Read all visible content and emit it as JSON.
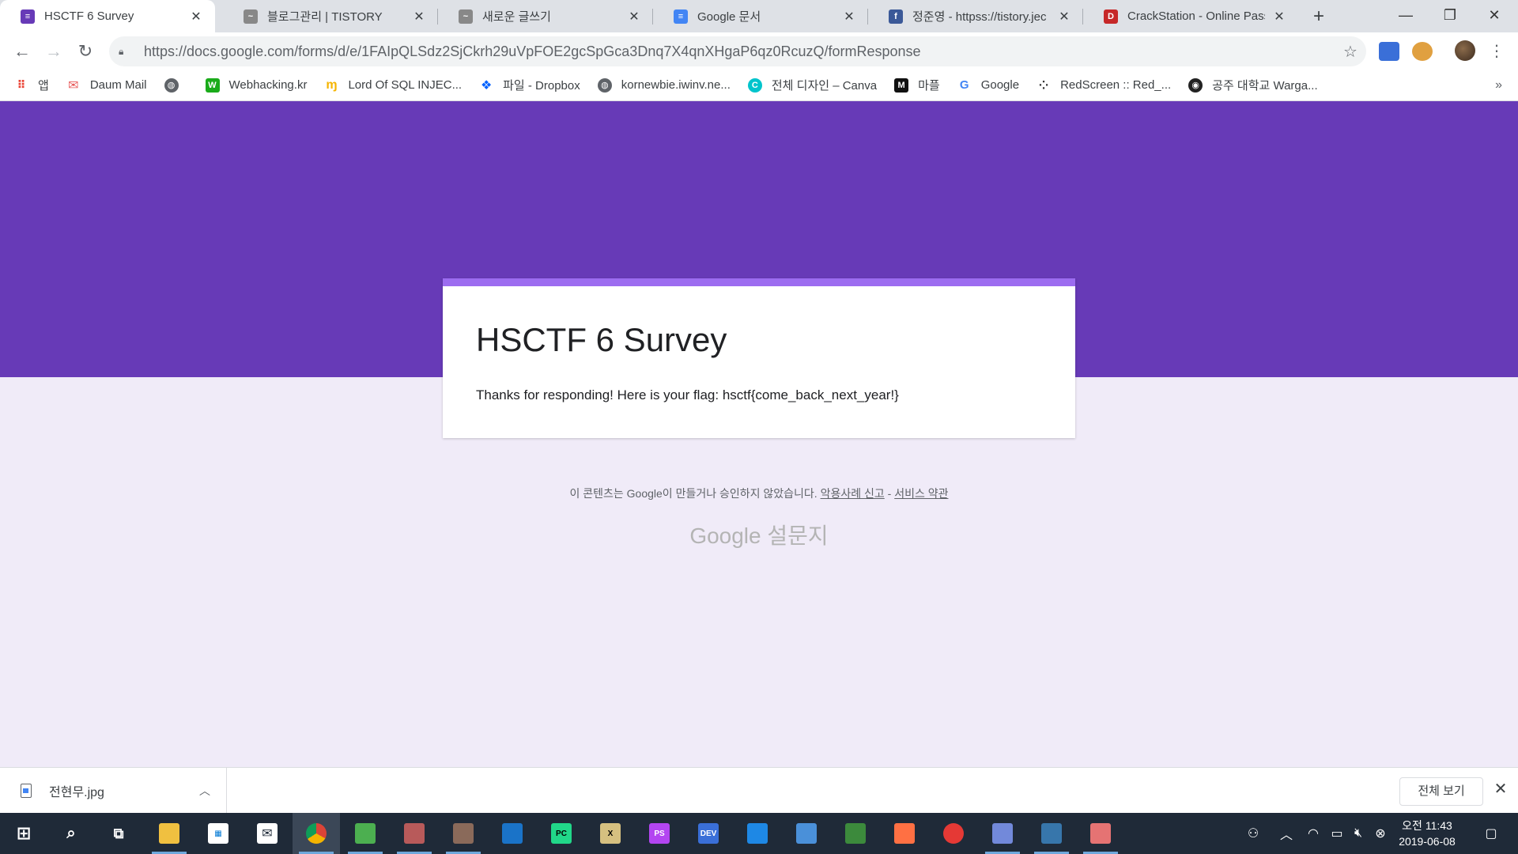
{
  "browser": {
    "tabs": [
      {
        "title": "HSCTF 6 Survey",
        "favicon": "google-forms-icon",
        "color": "#673ab7",
        "active": true
      },
      {
        "title": "블로그관리 | TISTORY",
        "favicon": "tistory-icon",
        "color": "#888888"
      },
      {
        "title": "새로운 글쓰기",
        "favicon": "tistory-icon",
        "color": "#888888"
      },
      {
        "title": "Google 문서",
        "favicon": "google-docs-icon",
        "color": "#4285f4"
      },
      {
        "title": "정준영 - httpss://tistory.jec",
        "favicon": "facebook-icon",
        "color": "#3b5998"
      },
      {
        "title": "CrackStation - Online Passw",
        "favicon": "crackstation-icon",
        "color": "#c62828"
      }
    ],
    "new_tab_symbol": "+",
    "window_controls": {
      "minimize": "—",
      "maximize": "❐",
      "close": "✕"
    },
    "url": "https://docs.google.com/forms/d/e/1FAIpQLSdz2SjCkrh29uVpFOE2gcSpGca3Dnq7X4qnXHgaP6qz0RcuzQ/formResponse",
    "bookmarks": [
      {
        "label": "앱",
        "icon": "apps-grid-icon",
        "color": "#ea4335"
      },
      {
        "label": "Daum Mail",
        "icon": "mail-icon",
        "color": "#e85b5b"
      },
      {
        "label": "",
        "icon": "globe-icon",
        "color": "#5f6368"
      },
      {
        "label": "Webhacking.kr",
        "icon": "webhacking-icon",
        "color": "#1aab1a"
      },
      {
        "label": "Lord Of SQL INJEC...",
        "icon": "mcdonalds-icon",
        "color": "#f5b400"
      },
      {
        "label": "파일 - Dropbox",
        "icon": "dropbox-icon",
        "color": "#0061ff"
      },
      {
        "label": "kornewbie.iwinv.ne...",
        "icon": "globe-icon",
        "color": "#5f6368"
      },
      {
        "label": "전체 디자인 – Canva",
        "icon": "canva-icon",
        "color": "#00c4cc"
      },
      {
        "label": "마플",
        "icon": "marpple-icon",
        "color": "#111111"
      },
      {
        "label": "Google",
        "icon": "google-icon",
        "color": "#4285f4"
      },
      {
        "label": "RedScreen :: Red_...",
        "icon": "redscreen-icon",
        "color": "#333333"
      },
      {
        "label": "공주 대학교 Warga...",
        "icon": "wargame-icon",
        "color": "#222222"
      }
    ],
    "bookmarks_overflow": "»"
  },
  "form": {
    "title": "HSCTF 6 Survey",
    "confirmation": "Thanks for responding! Here is your flag: hsctf{come_back_next_year!}",
    "footer_text": "이 콘텐츠는 Google이 만들거나 승인하지 않았습니다. ",
    "report_link": "악용사례 신고",
    "separator": " - ",
    "terms_link": "서비스 약관",
    "logo_text": "Google 설문지",
    "banner_color": "#673ab7",
    "accent_color": "#9c6cf0"
  },
  "downloads": {
    "file_name": "전현무.jpg",
    "show_all": "전체 보기",
    "close": "✕"
  },
  "taskbar": {
    "time": "오전 11:43",
    "date": "2019-06-08",
    "apps": [
      {
        "name": "start-icon",
        "color": "#ffffff"
      },
      {
        "name": "search-icon",
        "color": "#ffffff"
      },
      {
        "name": "task-view-icon",
        "color": "#ffffff"
      },
      {
        "name": "file-explorer-icon",
        "color": "#f0c040"
      },
      {
        "name": "store-icon",
        "color": "#ffffff"
      },
      {
        "name": "mail-icon",
        "color": "#ffffff"
      },
      {
        "name": "chrome-icon",
        "color": "#e34133"
      },
      {
        "name": "image-viewer-icon",
        "color": "#4caf50"
      },
      {
        "name": "photo-app-icon",
        "color": "#b85a5a"
      },
      {
        "name": "photo-app-2-icon",
        "color": "#8a6a5a"
      },
      {
        "name": "wireshark-icon",
        "color": "#1a73c8"
      },
      {
        "name": "pycharm-icon",
        "color": "#21d789"
      },
      {
        "name": "x64dbg-icon",
        "color": "#d6c080"
      },
      {
        "name": "phpstorm-icon",
        "color": "#b345f1"
      },
      {
        "name": "devcpp-icon",
        "color": "#3a6fd8"
      },
      {
        "name": "virtualbox-icon",
        "color": "#1e88e5"
      },
      {
        "name": "network-icon",
        "color": "#4a90d9"
      },
      {
        "name": "editor-icon",
        "color": "#3c8a3c"
      },
      {
        "name": "sublime-icon",
        "color": "#ff7043"
      },
      {
        "name": "burp-icon",
        "color": "#e53935"
      },
      {
        "name": "discord-icon",
        "color": "#7289da"
      },
      {
        "name": "python-icon",
        "color": "#3776ab"
      },
      {
        "name": "snipping-icon",
        "color": "#e57373"
      }
    ]
  }
}
